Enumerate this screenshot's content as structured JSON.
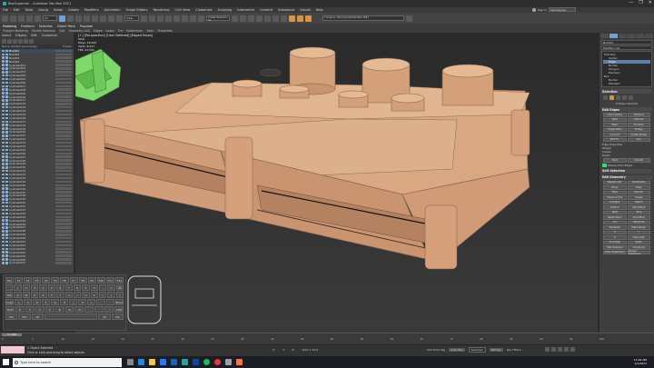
{
  "window": {
    "title": "BoxOrganizer - Autodesk 3ds Max 2021",
    "controls": [
      "—",
      "❐",
      "✕"
    ]
  },
  "menu": [
    "File",
    "Edit",
    "Tools",
    "Group",
    "Views",
    "Create",
    "Modifiers",
    "Animation",
    "Graph Editors",
    "Rendering",
    "Civil View",
    "Customize",
    "Scripting",
    "Interactive",
    "Content",
    "Substance",
    "Arnold",
    "Help"
  ],
  "user": {
    "name": "Sign In",
    "workspace": "Workspaces: Default"
  },
  "toolbar": {
    "selection_filter": "All",
    "create_selection_set": "Create Selection Se",
    "view_dropdown": "View",
    "path": "C:\\Users\\...\\Documents\\3ds Max 2021"
  },
  "ribbon": {
    "tabs": [
      "Modeling",
      "Freeform",
      "Selection",
      "Object Paint",
      "Populate"
    ],
    "subtabs": [
      "Polygon Modeling",
      "Modify Selection",
      "Edit",
      "Geometry (All)",
      "Edges",
      "Loops",
      "Tris",
      "Subdivision",
      "Align",
      "Properties"
    ]
  },
  "scene_explorer": {
    "menu": [
      "Select",
      "Display",
      "Edit",
      "Customize"
    ],
    "header_name": "Name (Sorted Ascending)",
    "header_frozen": "Frozen",
    "rows": [
      "Box001",
      "Box002",
      "Box003",
      "Box004",
      "Cylinder001",
      "Cylinder002",
      "Cylinder003",
      "Cylinder004",
      "Cylinder005",
      "Cylinder006",
      "Cylinder007",
      "Cylinder008",
      "Cylinder009",
      "Cylinder010",
      "Cylinder011",
      "Cylinder012",
      "Cylinder013",
      "Cylinder014",
      "Cylinder015",
      "Cylinder016",
      "Cylinder017",
      "Cylinder018",
      "Cylinder019",
      "Cylinder020",
      "Cylinder021",
      "Cylinder022",
      "Cylinder023",
      "Cylinder024",
      "Cylinder025",
      "Cylinder026",
      "Cylinder027",
      "Cylinder028",
      "Cylinder029",
      "Cylinder030",
      "Cylinder031",
      "Cylinder032",
      "Cylinder033",
      "Cylinder034",
      "Cylinder035",
      "Cylinder036",
      "Cylinder037",
      "Cylinder038",
      "Cylinder039",
      "Cylinder040",
      "Cylinder041",
      "Cylinder042",
      "Cylinder043",
      "Cylinder044",
      "Cylinder045",
      "Cylinder046",
      "Cylinder047",
      "Cylinder048",
      "Cylinder049",
      "Cylinder050",
      "Cylinder051",
      "Cylinder052",
      "Cylinder053",
      "Cylinder054",
      "Cylinder055",
      "Cylinder056",
      "Cylinder057"
    ]
  },
  "viewport": {
    "label": "[+] [Perspective] [User Defined] [Edged Faces]",
    "stats": [
      "Total",
      "Polys: 15,042",
      "Verts: 8,417",
      "FPS: 23.541"
    ]
  },
  "keyboard": {
    "rows": [
      [
        "Esc",
        "F1",
        "F2",
        "F3",
        "F4",
        "F5",
        "F6",
        "F7",
        "F8",
        "F9",
        "F10",
        "F11",
        "F12"
      ],
      [
        "`",
        "1",
        "2",
        "3",
        "4",
        "5",
        "6",
        "7",
        "8",
        "9",
        "0",
        "-",
        "=",
        "⌫"
      ],
      [
        "Tab",
        "Q",
        "W",
        "E",
        "R",
        "T",
        "Y",
        "U",
        "I",
        "O",
        "P",
        "[",
        "]",
        "\\"
      ],
      [
        "Caps",
        "A",
        "S",
        "D",
        "F",
        "G",
        "H",
        "J",
        "K",
        "L",
        ";",
        "'",
        "Enter"
      ],
      [
        "Shift",
        "Z",
        "X",
        "C",
        "V",
        "B",
        "N",
        "M",
        ",",
        ".",
        "/",
        "Shift"
      ],
      [
        "Ctrl",
        "Win",
        "Alt",
        "",
        "Alt",
        "Ctrl"
      ]
    ]
  },
  "command_panel": {
    "object_name": "Box001",
    "modifier_list": "Modifier List",
    "stack": [
      "Edit Poly",
      "Vertex",
      "Edge",
      "Border",
      "Polygon",
      "Element",
      "Box",
      "Border",
      "Element"
    ],
    "stack_selected": "Edge",
    "sections": {
      "selection": "Selection",
      "edit_edges": "Edit Edges",
      "edit_geometry": "Edit Geometry",
      "soft_selection": "Soft Selection",
      "surface_properties": "Edge Properties"
    },
    "selection_info": "8 Edges Selected",
    "edit_edges_buttons": [
      "Insert Vertex",
      "Remove",
      "Split",
      "Extrude",
      "Weld",
      "Chamfer",
      "Target Weld",
      "Bridge",
      "Connect",
      "Create Shape",
      "Edit Tri.",
      "Turn"
    ],
    "edge_props": [
      "Weight",
      "Crease",
      "Depth"
    ],
    "hard_smooth": [
      "Hard",
      "Smooth"
    ],
    "display_hard": "Display Hard Edges",
    "edit_geometry_buttons": [
      "Repeat Last",
      "Constraints",
      "None",
      "Edge",
      "Face",
      "Normal",
      "Preserve UVs",
      "Create",
      "Collapse",
      "Attach",
      "Detach",
      "Slice Plane",
      "Split",
      "Slice",
      "Reset Plane",
      "QuickSlice",
      "Cut",
      "MSmooth",
      "Tessellate",
      "Make Planar",
      "X",
      "Y",
      "Z",
      "View Align",
      "Grid Align",
      "Relax",
      "Hide Selected",
      "Unhide All",
      "Hide Unselected",
      "Named Selections:"
    ]
  },
  "timeline": {
    "frame": "0 / 100",
    "ticks": [
      "0",
      "5",
      "10",
      "15",
      "20",
      "25",
      "30",
      "35",
      "40",
      "45",
      "50",
      "55",
      "60",
      "65",
      "70",
      "75",
      "80",
      "85",
      "90",
      "95",
      "100"
    ]
  },
  "status": {
    "line1": "1 Object Selected",
    "line2": "Click or click-and-drag to select objects",
    "coords": {
      "x": "X:",
      "y": "Y:",
      "z": "Z:"
    },
    "grid": "Grid = 10.0",
    "time_tag": "Add Time Tag",
    "autokey": "Auto Key",
    "selected": "Selected",
    "setkey": "Set Key",
    "keyfilters": "Key Filters..."
  },
  "taskbar": {
    "search": "Type here to search",
    "time": "11:02 AM",
    "date": "1/1/2021"
  }
}
